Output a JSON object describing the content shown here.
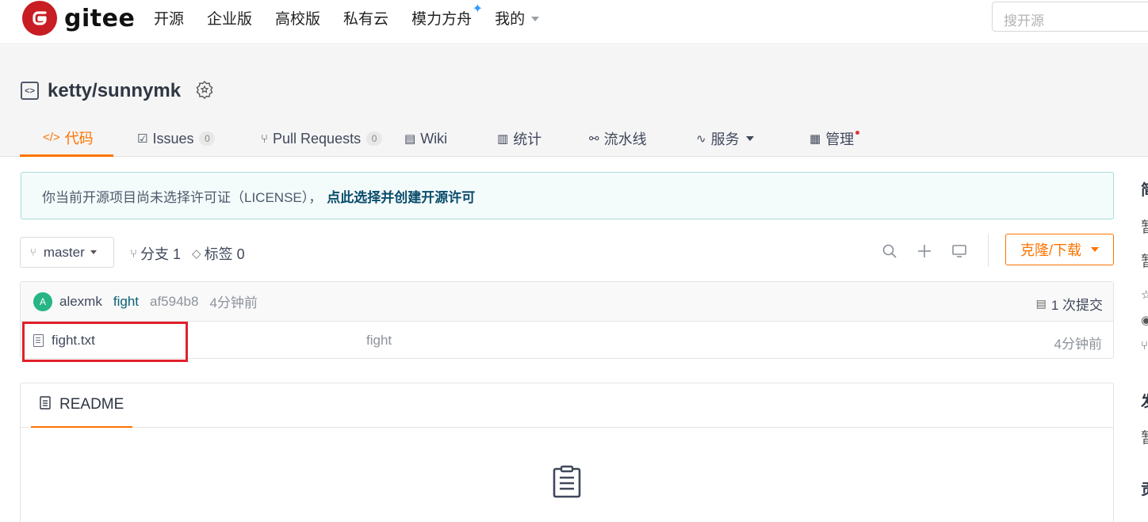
{
  "nav": {
    "logo_text": "gitee",
    "items": [
      {
        "label": "开源"
      },
      {
        "label": "企业版"
      },
      {
        "label": "高校版"
      },
      {
        "label": "私有云"
      },
      {
        "label": "模力方舟"
      },
      {
        "label": "我的"
      }
    ],
    "search_placeholder": "搜开源"
  },
  "repo": {
    "name": "ketty/sunnymk",
    "tabs": [
      {
        "label": "代码",
        "active": true
      },
      {
        "label": "Issues",
        "count": "0"
      },
      {
        "label": "Pull Requests",
        "count": "0"
      },
      {
        "label": "Wiki"
      },
      {
        "label": "统计"
      },
      {
        "label": "流水线"
      },
      {
        "label": "服务"
      },
      {
        "label": "管理"
      }
    ]
  },
  "notice": {
    "text": "你当前开源项目尚未选择许可证（LICENSE），",
    "link": "点此选择并创建开源许可"
  },
  "branch": {
    "current": "master",
    "branches_label": "分支 1",
    "tags_label": "标签 0",
    "clone_label": "克隆/下载"
  },
  "commit": {
    "avatar_letter": "A",
    "author": "alexmk",
    "message": "fight",
    "sha": "af594b8",
    "time": "4分钟前",
    "count_label": "1 次提交"
  },
  "files": [
    {
      "name": "fight.txt",
      "message": "fight",
      "time": "4分钟前"
    }
  ],
  "readme": {
    "tab_label": "README"
  },
  "sidebar": {
    "chars": [
      "简",
      "暂",
      "暂",
      "发",
      "暂",
      "贡"
    ]
  },
  "colors": {
    "accent": "#fe7300",
    "brand": "#c71d23",
    "highlight": "#e0202a"
  }
}
